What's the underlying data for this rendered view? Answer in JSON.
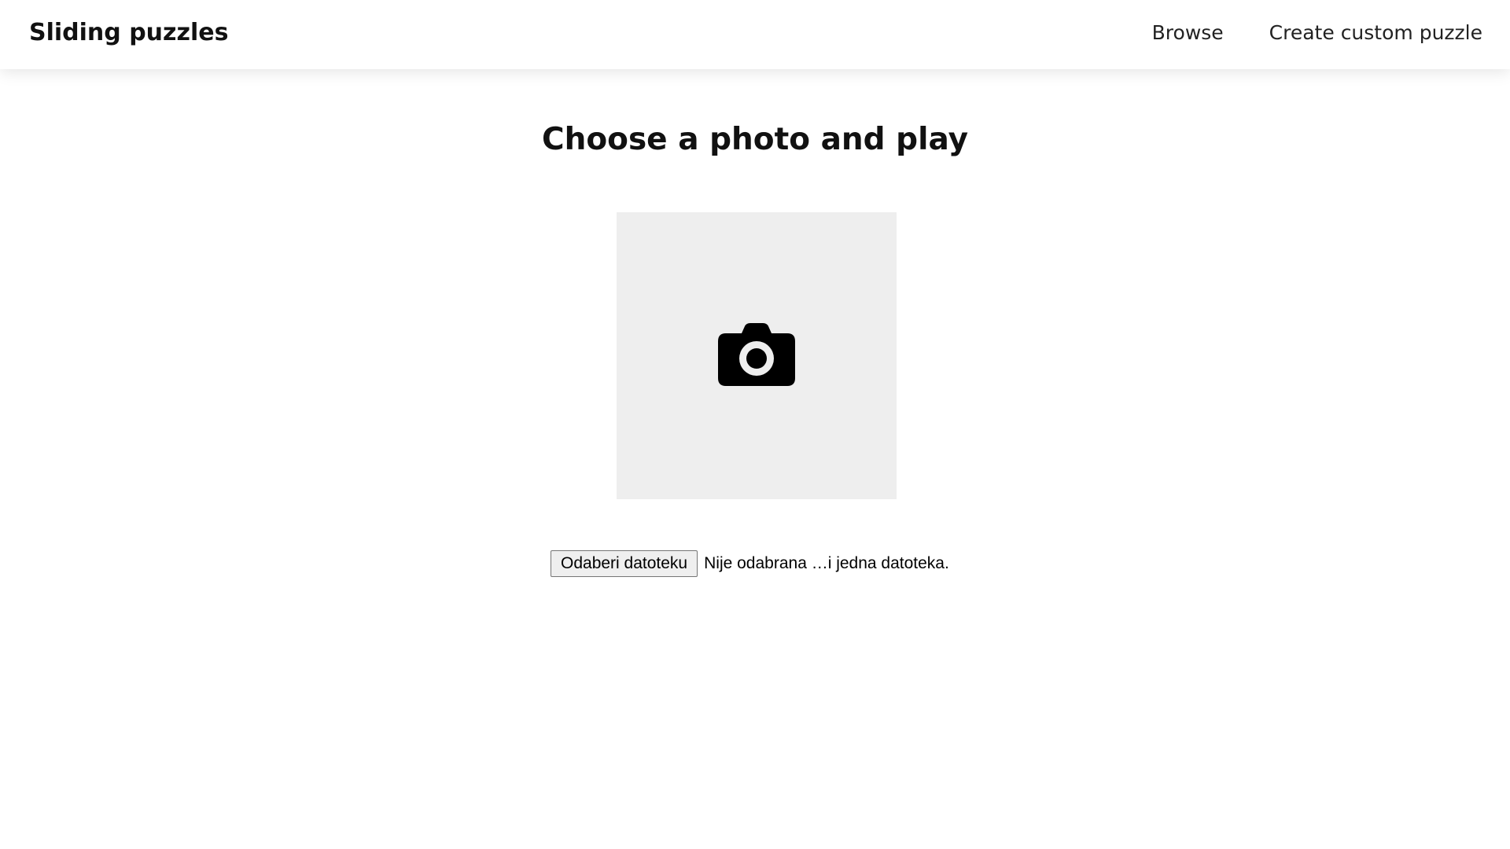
{
  "header": {
    "brand": "Sliding puzzles",
    "nav": [
      {
        "label": "Browse"
      },
      {
        "label": "Create custom puzzle"
      }
    ]
  },
  "main": {
    "heading": "Choose a photo and play",
    "photo_placeholder": {
      "icon": "camera-icon",
      "background": "#eeeeee"
    },
    "file_input": {
      "button_label": "Odaberi datoteku",
      "status_text": "Nije odabrana …i jedna datoteka."
    }
  }
}
